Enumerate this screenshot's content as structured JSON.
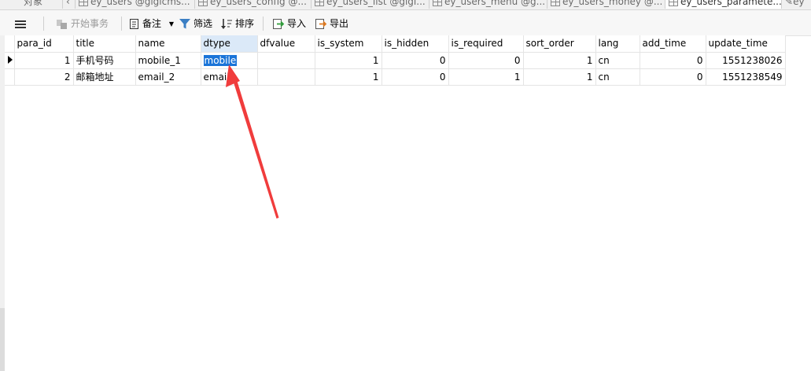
{
  "tabs": [
    {
      "label": "对象",
      "active": false
    },
    {
      "label": "ey_users @gigicms...",
      "active": false
    },
    {
      "label": "ey_users_config @...",
      "active": false
    },
    {
      "label": "ey_users_list @gigi...",
      "active": false
    },
    {
      "label": "ey_users_menu @g...",
      "active": false
    },
    {
      "label": "ey_users_money @...",
      "active": false
    },
    {
      "label": "ey_users_paramete...",
      "active": true
    },
    {
      "label": "ey",
      "active": false
    }
  ],
  "toolbar": {
    "begin_transaction": "开始事务",
    "memo": "备注",
    "filter": "筛选",
    "sort": "排序",
    "import": "导入",
    "export": "导出"
  },
  "grid": {
    "columns": [
      "para_id",
      "title",
      "name",
      "dtype",
      "dfvalue",
      "is_system",
      "is_hidden",
      "is_required",
      "sort_order",
      "lang",
      "add_time",
      "update_time"
    ],
    "rows": [
      {
        "para_id": "1",
        "title": "手机号码",
        "name": "mobile_1",
        "dtype": "mobile",
        "dfvalue": "",
        "is_system": "1",
        "is_hidden": "0",
        "is_required": "0",
        "sort_order": "1",
        "lang": "cn",
        "add_time": "0",
        "update_time": "1551238026"
      },
      {
        "para_id": "2",
        "title": "邮箱地址",
        "name": "email_2",
        "dtype": "email",
        "dfvalue": "",
        "is_system": "1",
        "is_hidden": "0",
        "is_required": "1",
        "sort_order": "1",
        "lang": "cn",
        "add_time": "0",
        "update_time": "1551238549"
      }
    ]
  },
  "colors": {
    "selection": "#1a74d8",
    "selected_header": "#dbe9f8",
    "annotation_arrow": "#f03c3c"
  }
}
